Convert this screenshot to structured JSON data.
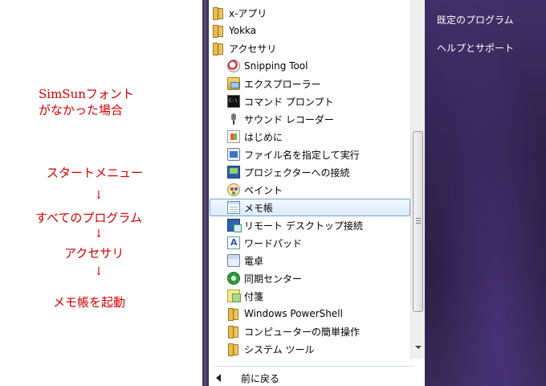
{
  "annotation": {
    "line1": "SimSunフォント",
    "line2": "がなかった場合",
    "steps": [
      "スタートメニュー",
      "アクセサリ",
      "メモ帳を起動"
    ],
    "step_all_programs": "すべてのプログラム",
    "arrow": "↓"
  },
  "programs": {
    "items": [
      {
        "label": "x-アプリ"
      },
      {
        "label": "Yokka"
      },
      {
        "label": "アクセサリ"
      },
      {
        "label": "Snipping Tool"
      },
      {
        "label": "エクスプローラー"
      },
      {
        "label": "コマンド プロンプト"
      },
      {
        "label": "サウンド レコーダー"
      },
      {
        "label": "はじめに"
      },
      {
        "label": "ファイル名を指定して実行"
      },
      {
        "label": "プロジェクターへの接続"
      },
      {
        "label": "ペイント"
      },
      {
        "label": "メモ帳"
      },
      {
        "label": "リモート デスクトップ接続"
      },
      {
        "label": "ワードパッド"
      },
      {
        "label": "電卓"
      },
      {
        "label": "同期センター"
      },
      {
        "label": "付箋"
      },
      {
        "label": "Windows PowerShell"
      },
      {
        "label": "コンピューターの簡単操作"
      },
      {
        "label": "システム ツール"
      }
    ],
    "back_label": "前に戻る"
  },
  "right_pane": {
    "default_programs": "既定のプログラム",
    "help_support": "ヘルプとサポート"
  },
  "colors": {
    "annotation_red": "#d00000",
    "selection_border": "#7da2ce",
    "right_pane_bg": "#2c2148"
  }
}
